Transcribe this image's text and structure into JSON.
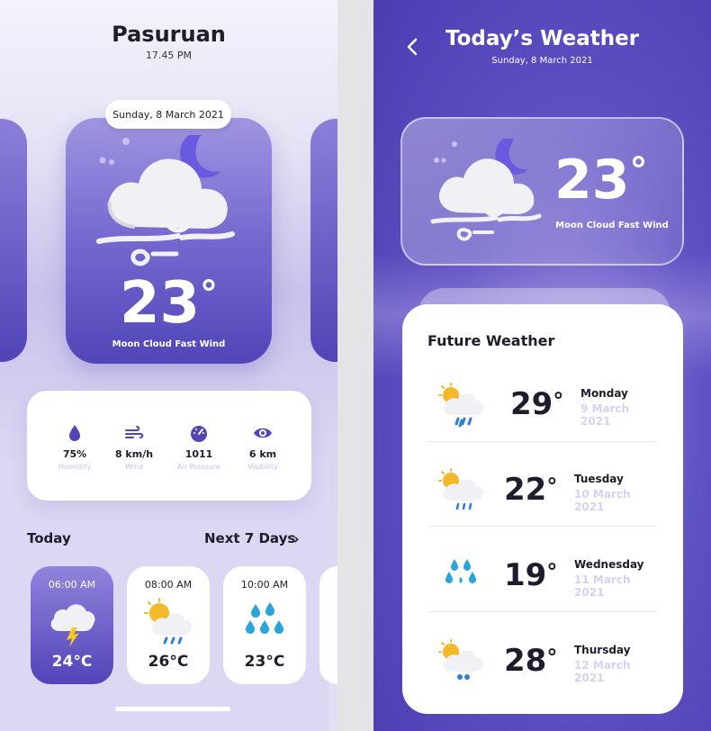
{
  "left": {
    "city": "Pasuruan",
    "time": "17.45 PM",
    "date": "Sunday, 8 March 2021",
    "temp": "23",
    "degree": "°",
    "condition": "Moon Cloud Fast Wind",
    "stats": [
      {
        "value": "75%",
        "label": "Humidity",
        "icon": "drop-icon"
      },
      {
        "value": "8 km/h",
        "label": "Wind",
        "icon": "wind-icon"
      },
      {
        "value": "1011",
        "label": "Air Pressure",
        "icon": "gauge-icon"
      },
      {
        "value": "6 km",
        "label": "Visibility",
        "icon": "eye-icon"
      }
    ],
    "today_label": "Today",
    "next_label": "Next 7 Days",
    "next_chevron": "›",
    "hourly": [
      {
        "time": "06:00 AM",
        "temp": "24°C",
        "icon": "storm-cloud-icon"
      },
      {
        "time": "08:00 AM",
        "temp": "26°C",
        "icon": "sun-rain-cloud-icon"
      },
      {
        "time": "10:00 AM",
        "temp": "23°C",
        "icon": "rain-drops-icon"
      }
    ]
  },
  "right": {
    "title": "Today’s Weather",
    "date": "Sunday, 8 March 2021",
    "temp": "23",
    "degree": "°",
    "condition": "Moon Cloud Fast Wind",
    "future_title": "Future Weather",
    "forecast": [
      {
        "temp": "29",
        "day": "Monday",
        "date": "9 March 2021",
        "icon": "sun-rain-cloud-icon"
      },
      {
        "temp": "22",
        "day": "Tuesday",
        "date": "10 March 2021",
        "icon": "sun-rain-cloud-icon"
      },
      {
        "temp": "19",
        "day": "Wednesday",
        "date": "11 March 2021",
        "icon": "rain-drops-icon"
      },
      {
        "temp": "28",
        "day": "Thursday",
        "date": "12 March 2021",
        "icon": "sun-rain-cloud-icon"
      }
    ]
  },
  "colors": {
    "accent": "#5245b8",
    "accent_light": "#8f84dc",
    "muted_label": "#c6c0e6",
    "text_dark": "#1d1d2b"
  }
}
